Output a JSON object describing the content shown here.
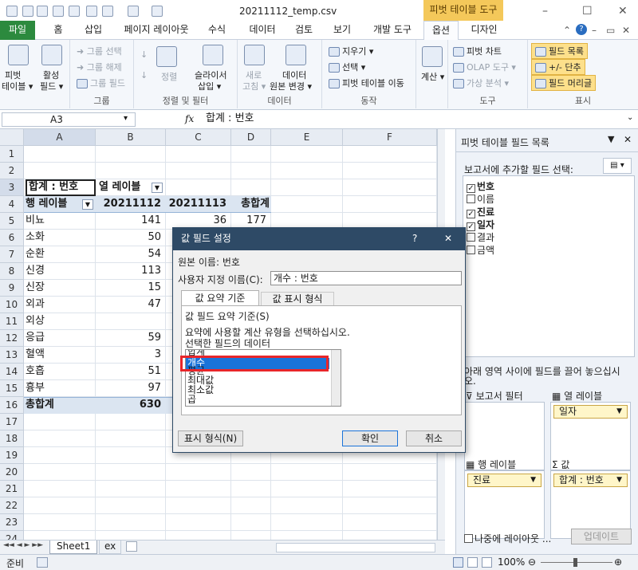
{
  "window": {
    "title": "20211112_temp.csv",
    "context_tab": "피벗 테이블 도구",
    "minimize": "–",
    "restore": "☐",
    "close": "✕"
  },
  "tabs": [
    "파일",
    "홈",
    "삽입",
    "페이지 레이아웃",
    "수식",
    "데이터",
    "검토",
    "보기",
    "개발 도구",
    "옵션",
    "디자인"
  ],
  "ribbon": {
    "pivot": {
      "btn1": "피벗",
      "btn1b": "테이블 ▾",
      "btn2": "활성",
      "btn2b": "필드 ▾"
    },
    "group": {
      "select": "➜ 그룹 선택",
      "ungroup": "➜ 그룹 해제",
      "field": "그룹 필드",
      "label": "그룹"
    },
    "sort": {
      "sort": "정렬",
      "slicer": "슬라이서",
      "slicer_b": "삽입 ▾",
      "label": "정렬 및 필터"
    },
    "data": {
      "refresh": "새로",
      "refresh_b": "고침 ▾",
      "source": "데이터",
      "source_b": "원본 변경 ▾",
      "label": "데이터"
    },
    "actions": {
      "clear": "지우기 ▾",
      "select": "선택 ▾",
      "move": "피벗 테이블 이동",
      "label": "동작"
    },
    "calc": {
      "label": "계산",
      "btn": "계산 ▾"
    },
    "tools": {
      "chart": "피벗 차트",
      "olap": "OLAP 도구 ▾",
      "whatif": "가상 분석 ▾",
      "label": "도구"
    },
    "show": {
      "fieldlist": "필드 목록",
      "buttons": "+/- 단추",
      "headers": "필드 머리글",
      "label": "표시"
    }
  },
  "formula": {
    "namebox": "A3",
    "fx": "fx",
    "value": "합계 : 번호"
  },
  "columns": [
    "A",
    "B",
    "C",
    "D",
    "E",
    "F"
  ],
  "rows": [
    "1",
    "2",
    "3",
    "4",
    "5",
    "6",
    "7",
    "8",
    "9",
    "10",
    "11",
    "12",
    "13",
    "14",
    "15",
    "16",
    "17",
    "18",
    "19",
    "20",
    "21",
    "22",
    "23",
    "24"
  ],
  "pivot": {
    "header_value": "합계 : 번호",
    "col_label": "열 레이블",
    "row_label": "행 레이블",
    "col_dates": [
      "20211112",
      "20211113"
    ],
    "grand_total_col": "총합계",
    "items": [
      {
        "name": "비뇨",
        "b": "141",
        "c": "36",
        "d": "177"
      },
      {
        "name": "소화",
        "b": "50",
        "c": "",
        "d": ""
      },
      {
        "name": "순환",
        "b": "54",
        "c": "",
        "d": ""
      },
      {
        "name": "신경",
        "b": "113",
        "c": "",
        "d": ""
      },
      {
        "name": "신장",
        "b": "15",
        "c": "",
        "d": ""
      },
      {
        "name": "외과",
        "b": "47",
        "c": "",
        "d": ""
      },
      {
        "name": "외상",
        "b": "",
        "c": "",
        "d": ""
      },
      {
        "name": "응급",
        "b": "59",
        "c": "",
        "d": ""
      },
      {
        "name": "혈액",
        "b": "3",
        "c": "",
        "d": ""
      },
      {
        "name": "호흡",
        "b": "51",
        "c": "",
        "d": ""
      },
      {
        "name": "흉부",
        "b": "97",
        "c": "",
        "d": ""
      }
    ],
    "grand_total_row": "총합계",
    "grand_total_b": "630"
  },
  "sheets": [
    "Sheet1",
    "ex"
  ],
  "status": {
    "ready": "준비",
    "zoom": "100%"
  },
  "field_panel": {
    "title": "피벗 테이블 필드 목록",
    "choose": "보고서에 추가할 필드 선택:",
    "fields": [
      {
        "name": "번호",
        "checked": true
      },
      {
        "name": "이름",
        "checked": false
      },
      {
        "name": "진료",
        "checked": true
      },
      {
        "name": "일자",
        "checked": true
      },
      {
        "name": "결과",
        "checked": false
      },
      {
        "name": "금액",
        "checked": false
      }
    ],
    "drag_hint": "아래 영역 사이에 필드를 끌어 놓으십시오.",
    "report_filter": "보고서 필터",
    "col_labels": "열 레이블",
    "row_labels": "행 레이블",
    "values": "값",
    "col_item": "일자",
    "row_item": "진료",
    "value_item": "합계 : 번호",
    "defer": "나중에 레이아웃 ...",
    "update": "업데이트"
  },
  "dialog": {
    "title": "값 필드 설정",
    "help": "?",
    "close": "✕",
    "source_label": "원본 이름:",
    "source_name": "번호",
    "custom_label": "사용자 지정 이름(C):",
    "custom_value": "개수 : 번호",
    "tab1": "값 요약 기준",
    "tab2": "값 표시 형식",
    "section": "값 필드 요약 기준(S)",
    "desc1": "요약에 사용할 계산 유형을 선택하십시오.",
    "desc2": "선택한 필드의 데이터",
    "options": [
      "합계",
      "개수",
      "평균",
      "최대값",
      "최소값",
      "곱"
    ],
    "selected": "개수",
    "number_format": "표시 형식(N)",
    "ok": "확인",
    "cancel": "취소"
  },
  "colors": {
    "accent": "#2e4a66",
    "file_tab": "#2c8a3e",
    "highlight": "#e8262a",
    "selection": "#1a73d9"
  }
}
